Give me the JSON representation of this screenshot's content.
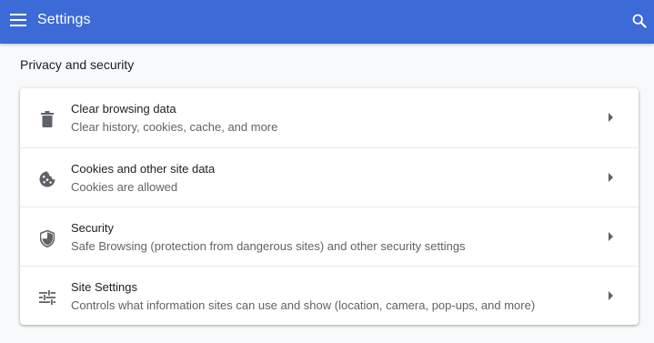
{
  "header": {
    "title": "Settings",
    "menu_icon": "hamburger-menu-icon",
    "search_icon": "search-icon",
    "background_color": "#3c6ad6"
  },
  "section": {
    "title": "Privacy and security"
  },
  "items": [
    {
      "icon": "trash-icon",
      "label": "Clear browsing data",
      "description": "Clear history, cookies, cache, and more"
    },
    {
      "icon": "cookie-icon",
      "label": "Cookies and other site data",
      "description": "Cookies are allowed"
    },
    {
      "icon": "shield-icon",
      "label": "Security",
      "description": "Safe Browsing (protection from dangerous sites) and other security settings"
    },
    {
      "icon": "tune-sliders-icon",
      "label": "Site Settings",
      "description": "Controls what information sites can use and show (location, camera, pop-ups, and more)"
    }
  ]
}
